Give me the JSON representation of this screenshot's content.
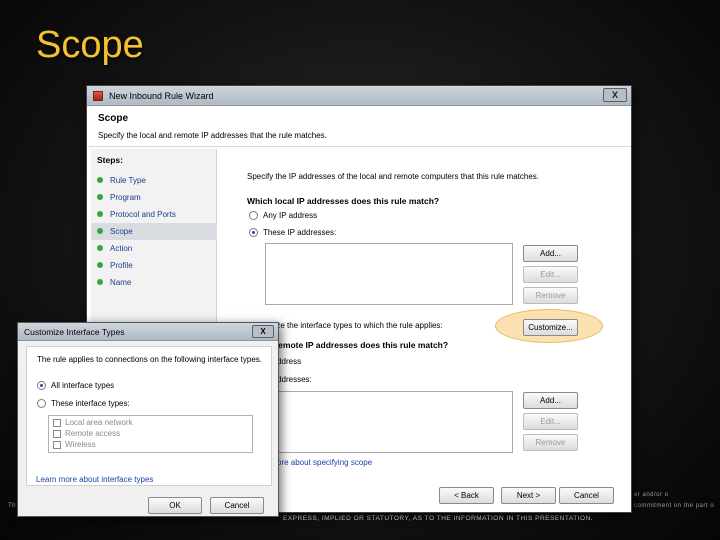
{
  "slide": {
    "title": "Scope",
    "footer": "EXPRESS, IMPLIED OR STATUTORY, AS TO THE INFORMATION IN THIS PRESENTATION.",
    "bg_left": "Th",
    "bg_right_1": "er and/or o",
    "bg_right_2": "commitment on the part o"
  },
  "wizard": {
    "title": "New Inbound Rule Wizard",
    "header_title": "Scope",
    "header_desc": "Specify the local and remote IP addresses that the rule matches.",
    "steps_title": "Steps:",
    "steps": [
      "Rule Type",
      "Program",
      "Protocol and Ports",
      "Scope",
      "Action",
      "Profile",
      "Name"
    ],
    "active_step": 3,
    "intro": "Specify the IP addresses of the local and remote computers that this rule matches.",
    "local_question": "Which local IP addresses does this rule match?",
    "local_any": "Any IP address",
    "local_these": "These IP addresses:",
    "local_selected": "these",
    "buttons": {
      "add": "Add...",
      "edit": "Edit...",
      "remove": "Remove"
    },
    "customize_text": "Customize the interface types to which the rule applies:",
    "customize_button": "Customize...",
    "remote_question": "Which remote IP addresses does this rule match?",
    "remote_any_partial": "IP address",
    "remote_these_partial": "IP addresses:",
    "learn_more_partial": "ore about specifying scope",
    "back": "< Back",
    "next": "Next >",
    "cancel": "Cancel",
    "close": "X"
  },
  "customize": {
    "title": "Customize Interface Types",
    "close": "X",
    "desc": "The rule applies to connections on the following interface types.",
    "all": "All interface types",
    "these": "These interface types:",
    "selected": "all",
    "items": [
      "Local area network",
      "Remote access",
      "Wireless"
    ],
    "learn_more": "Learn more about interface types",
    "ok": "OK",
    "cancel": "Cancel"
  },
  "colors": {
    "title": "#f2c230",
    "link": "#1a3fb0",
    "step_dot": "#3aa33a",
    "highlight": "#f8c86e"
  }
}
